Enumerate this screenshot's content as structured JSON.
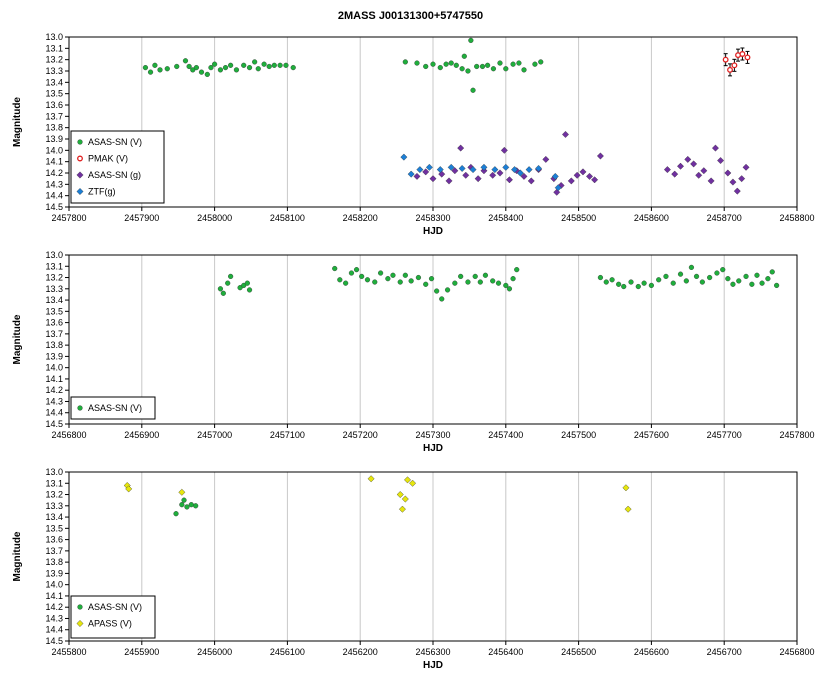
{
  "title": "2MASS J00131300+5747550",
  "chart_data": [
    {
      "type": "scatter",
      "xlabel": "HJD",
      "ylabel": "Magnitude",
      "xlim": [
        2457800,
        2458800
      ],
      "xticks": [
        2457800,
        2457900,
        2458000,
        2458100,
        2458200,
        2458300,
        2458400,
        2458500,
        2458600,
        2458700,
        2458800
      ],
      "ylim": [
        13.0,
        14.5
      ],
      "y_inverted": true,
      "yticks": [
        13.0,
        13.1,
        13.2,
        13.3,
        13.4,
        13.5,
        13.6,
        13.7,
        13.8,
        13.9,
        14.0,
        14.1,
        14.2,
        14.3,
        14.4,
        14.5
      ],
      "grid": "vertical",
      "legend_position": "bottom-left",
      "series": [
        {
          "name": "ASAS-SN (V)",
          "color": "#1fae3c",
          "marker": "circle",
          "points": [
            [
              2457905,
              13.27
            ],
            [
              2457912,
              13.31
            ],
            [
              2457918,
              13.25
            ],
            [
              2457925,
              13.29
            ],
            [
              2457935,
              13.28
            ],
            [
              2457948,
              13.26
            ],
            [
              2457960,
              13.21
            ],
            [
              2457965,
              13.26
            ],
            [
              2457970,
              13.29
            ],
            [
              2457975,
              13.27
            ],
            [
              2457982,
              13.31
            ],
            [
              2457990,
              13.33
            ],
            [
              2457995,
              13.27
            ],
            [
              2458000,
              13.24
            ],
            [
              2458008,
              13.29
            ],
            [
              2458015,
              13.27
            ],
            [
              2458022,
              13.25
            ],
            [
              2458030,
              13.29
            ],
            [
              2458040,
              13.25
            ],
            [
              2458048,
              13.27
            ],
            [
              2458055,
              13.22
            ],
            [
              2458060,
              13.28
            ],
            [
              2458068,
              13.24
            ],
            [
              2458075,
              13.26
            ],
            [
              2458082,
              13.25
            ],
            [
              2458090,
              13.25
            ],
            [
              2458098,
              13.25
            ],
            [
              2458108,
              13.27
            ],
            [
              2458262,
              13.22
            ],
            [
              2458278,
              13.23
            ],
            [
              2458290,
              13.26
            ],
            [
              2458300,
              13.24
            ],
            [
              2458310,
              13.27
            ],
            [
              2458318,
              13.24
            ],
            [
              2458325,
              13.23
            ],
            [
              2458332,
              13.25
            ],
            [
              2458340,
              13.28
            ],
            [
              2458343,
              13.17
            ],
            [
              2458348,
              13.3
            ],
            [
              2458352,
              13.03
            ],
            [
              2458355,
              13.47
            ],
            [
              2458360,
              13.26
            ],
            [
              2458368,
              13.26
            ],
            [
              2458375,
              13.25
            ],
            [
              2458383,
              13.28
            ],
            [
              2458392,
              13.23
            ],
            [
              2458400,
              13.28
            ],
            [
              2458410,
              13.24
            ],
            [
              2458418,
              13.23
            ],
            [
              2458425,
              13.29
            ],
            [
              2458440,
              13.24
            ],
            [
              2458448,
              13.22
            ]
          ]
        },
        {
          "name": "PMAK (V)",
          "color": "#e02020",
          "marker": "circle-errorbar",
          "points": [
            [
              2458702,
              13.2
            ],
            [
              2458708,
              13.29
            ],
            [
              2458714,
              13.25
            ],
            [
              2458719,
              13.16
            ],
            [
              2458725,
              13.15
            ],
            [
              2458732,
              13.18
            ]
          ]
        },
        {
          "name": "ASAS-SN (g)",
          "color": "#7030a0",
          "marker": "diamond",
          "points": [
            [
              2458278,
              14.23
            ],
            [
              2458290,
              14.19
            ],
            [
              2458300,
              14.25
            ],
            [
              2458312,
              14.21
            ],
            [
              2458322,
              14.27
            ],
            [
              2458330,
              14.18
            ],
            [
              2458338,
              13.98
            ],
            [
              2458345,
              14.22
            ],
            [
              2458352,
              14.15
            ],
            [
              2458362,
              14.25
            ],
            [
              2458370,
              14.18
            ],
            [
              2458382,
              14.22
            ],
            [
              2458392,
              14.2
            ],
            [
              2458398,
              14.0
            ],
            [
              2458405,
              14.26
            ],
            [
              2458415,
              14.18
            ],
            [
              2458425,
              14.23
            ],
            [
              2458435,
              14.27
            ],
            [
              2458445,
              14.17
            ],
            [
              2458455,
              14.08
            ],
            [
              2458466,
              14.25
            ],
            [
              2458470,
              14.37
            ],
            [
              2458476,
              14.31
            ],
            [
              2458482,
              13.86
            ],
            [
              2458490,
              14.27
            ],
            [
              2458498,
              14.22
            ],
            [
              2458506,
              14.19
            ],
            [
              2458515,
              14.23
            ],
            [
              2458522,
              14.26
            ],
            [
              2458530,
              14.05
            ],
            [
              2458622,
              14.17
            ],
            [
              2458632,
              14.21
            ],
            [
              2458640,
              14.14
            ],
            [
              2458650,
              14.08
            ],
            [
              2458658,
              14.12
            ],
            [
              2458665,
              14.22
            ],
            [
              2458672,
              14.18
            ],
            [
              2458682,
              14.27
            ],
            [
              2458688,
              13.98
            ],
            [
              2458695,
              14.09
            ],
            [
              2458705,
              14.2
            ],
            [
              2458712,
              14.28
            ],
            [
              2458718,
              14.36
            ],
            [
              2458724,
              14.25
            ],
            [
              2458730,
              14.15
            ]
          ]
        },
        {
          "name": "ZTF(g)",
          "color": "#1c7fd6",
          "marker": "diamond",
          "points": [
            [
              2458260,
              14.06
            ],
            [
              2458270,
              14.21
            ],
            [
              2458282,
              14.17
            ],
            [
              2458295,
              14.15
            ],
            [
              2458310,
              14.17
            ],
            [
              2458325,
              14.15
            ],
            [
              2458340,
              14.16
            ],
            [
              2458355,
              14.17
            ],
            [
              2458370,
              14.15
            ],
            [
              2458385,
              14.17
            ],
            [
              2458400,
              14.15
            ],
            [
              2458412,
              14.17
            ],
            [
              2458420,
              14.2
            ],
            [
              2458432,
              14.17
            ],
            [
              2458445,
              14.16
            ],
            [
              2458468,
              14.23
            ],
            [
              2458472,
              14.33
            ]
          ]
        }
      ]
    },
    {
      "type": "scatter",
      "xlabel": "HJD",
      "ylabel": "Magnitude",
      "xlim": [
        2456800,
        2457800
      ],
      "xticks": [
        2456800,
        2456900,
        2457000,
        2457100,
        2457200,
        2457300,
        2457400,
        2457500,
        2457600,
        2457700,
        2457800
      ],
      "ylim": [
        13.0,
        14.5
      ],
      "y_inverted": true,
      "yticks": [
        13.0,
        13.1,
        13.2,
        13.3,
        13.4,
        13.5,
        13.6,
        13.7,
        13.8,
        13.9,
        14.0,
        14.1,
        14.2,
        14.3,
        14.4,
        14.5
      ],
      "grid": "vertical",
      "legend_position": "bottom-left",
      "series": [
        {
          "name": "ASAS-SN (V)",
          "color": "#1fae3c",
          "marker": "circle",
          "points": [
            [
              2457008,
              13.3
            ],
            [
              2457012,
              13.34
            ],
            [
              2457018,
              13.25
            ],
            [
              2457022,
              13.19
            ],
            [
              2457035,
              13.29
            ],
            [
              2457040,
              13.27
            ],
            [
              2457045,
              13.25
            ],
            [
              2457048,
              13.31
            ],
            [
              2457165,
              13.12
            ],
            [
              2457172,
              13.22
            ],
            [
              2457180,
              13.25
            ],
            [
              2457188,
              13.16
            ],
            [
              2457195,
              13.13
            ],
            [
              2457202,
              13.19
            ],
            [
              2457210,
              13.22
            ],
            [
              2457220,
              13.24
            ],
            [
              2457228,
              13.16
            ],
            [
              2457238,
              13.21
            ],
            [
              2457245,
              13.18
            ],
            [
              2457255,
              13.24
            ],
            [
              2457262,
              13.18
            ],
            [
              2457270,
              13.23
            ],
            [
              2457280,
              13.2
            ],
            [
              2457290,
              13.26
            ],
            [
              2457298,
              13.21
            ],
            [
              2457305,
              13.32
            ],
            [
              2457312,
              13.39
            ],
            [
              2457320,
              13.31
            ],
            [
              2457330,
              13.25
            ],
            [
              2457338,
              13.19
            ],
            [
              2457348,
              13.24
            ],
            [
              2457358,
              13.19
            ],
            [
              2457365,
              13.24
            ],
            [
              2457372,
              13.18
            ],
            [
              2457382,
              13.23
            ],
            [
              2457390,
              13.25
            ],
            [
              2457400,
              13.27
            ],
            [
              2457405,
              13.3
            ],
            [
              2457410,
              13.21
            ],
            [
              2457415,
              13.13
            ],
            [
              2457530,
              13.2
            ],
            [
              2457538,
              13.24
            ],
            [
              2457546,
              13.22
            ],
            [
              2457555,
              13.26
            ],
            [
              2457562,
              13.28
            ],
            [
              2457572,
              13.24
            ],
            [
              2457582,
              13.28
            ],
            [
              2457590,
              13.25
            ],
            [
              2457600,
              13.27
            ],
            [
              2457610,
              13.22
            ],
            [
              2457620,
              13.19
            ],
            [
              2457630,
              13.25
            ],
            [
              2457640,
              13.17
            ],
            [
              2457648,
              13.23
            ],
            [
              2457655,
              13.11
            ],
            [
              2457662,
              13.19
            ],
            [
              2457670,
              13.24
            ],
            [
              2457680,
              13.2
            ],
            [
              2457690,
              13.16
            ],
            [
              2457698,
              13.13
            ],
            [
              2457705,
              13.21
            ],
            [
              2457712,
              13.26
            ],
            [
              2457720,
              13.23
            ],
            [
              2457730,
              13.19
            ],
            [
              2457738,
              13.26
            ],
            [
              2457745,
              13.18
            ],
            [
              2457752,
              13.25
            ],
            [
              2457760,
              13.21
            ],
            [
              2457766,
              13.15
            ],
            [
              2457772,
              13.27
            ]
          ]
        }
      ]
    },
    {
      "type": "scatter",
      "xlabel": "HJD",
      "ylabel": "Magnitude",
      "xlim": [
        2455800,
        2456800
      ],
      "xticks": [
        2455800,
        2455900,
        2456000,
        2456100,
        2456200,
        2456300,
        2456400,
        2456500,
        2456600,
        2456700,
        2456800
      ],
      "ylim": [
        13.0,
        14.5
      ],
      "y_inverted": true,
      "yticks": [
        13.0,
        13.1,
        13.2,
        13.3,
        13.4,
        13.5,
        13.6,
        13.7,
        13.8,
        13.9,
        14.0,
        14.1,
        14.2,
        14.3,
        14.4,
        14.5
      ],
      "grid": "vertical",
      "legend_position": "bottom-left",
      "series": [
        {
          "name": "ASAS-SN (V)",
          "color": "#1fae3c",
          "marker": "circle",
          "points": [
            [
              2455947,
              13.37
            ],
            [
              2455955,
              13.29
            ],
            [
              2455962,
              13.31
            ],
            [
              2455968,
              13.29
            ],
            [
              2455974,
              13.3
            ],
            [
              2455958,
              13.25
            ]
          ]
        },
        {
          "name": "APASS (V)",
          "color": "#e6e60e",
          "marker": "diamond",
          "points": [
            [
              2455880,
              13.12
            ],
            [
              2455882,
              13.15
            ],
            [
              2455955,
              13.18
            ],
            [
              2456215,
              13.06
            ],
            [
              2456255,
              13.2
            ],
            [
              2456258,
              13.33
            ],
            [
              2456262,
              13.24
            ],
            [
              2456265,
              13.07
            ],
            [
              2456272,
              13.1
            ],
            [
              2456565,
              13.14
            ],
            [
              2456568,
              13.33
            ]
          ]
        }
      ]
    }
  ]
}
